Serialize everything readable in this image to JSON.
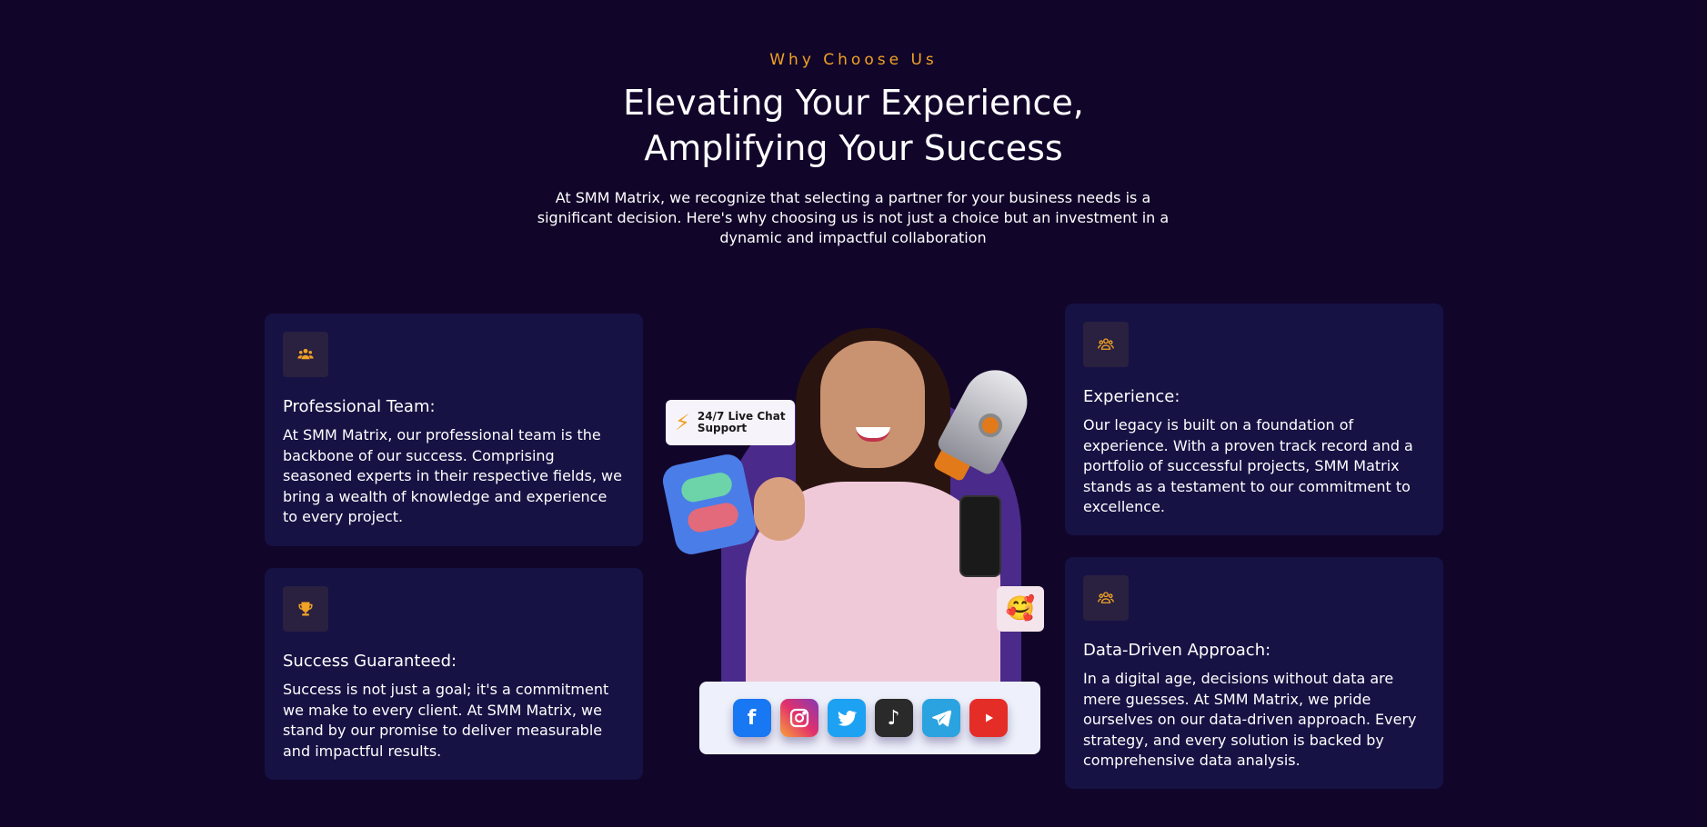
{
  "section": {
    "eyebrow": "Why Choose Us",
    "headline_line1": "Elevating Your Experience,",
    "headline_line2": "Amplifying Your Success",
    "intro": "At SMM Matrix, we recognize that selecting a partner for your business needs is a significant decision. Here's why choosing us is not just a choice but an investment in a dynamic and impactful collaboration"
  },
  "colors": {
    "background": "#12052a",
    "card": "#161244",
    "accent": "#f0a224",
    "icon_box": "#2a2040"
  },
  "cards": [
    {
      "icon": "team-icon",
      "title": "Professional Team:",
      "body": "At SMM Matrix, our professional team is the backbone of our success. Comprising seasoned experts in their respective fields, we bring a wealth of knowledge and experience to every project."
    },
    {
      "icon": "trophy-icon",
      "title": "Success Guaranteed:",
      "body": "Success is not just a goal; it's a commitment we make to every client. At SMM Matrix, we stand by our promise to deliver measurable and impactful results."
    },
    {
      "icon": "team-icon",
      "title": "Experience:",
      "body": "Our legacy is built on a foundation of experience. With a proven track record and a portfolio of successful projects, SMM Matrix stands as a testament to our commitment to excellence."
    },
    {
      "icon": "team-icon",
      "title": "Data-Driven Approach:",
      "body": "In a digital age, decisions without data are mere guesses. At SMM Matrix, we pride ourselves on our data-driven approach. Every strategy, and every solution is backed by comprehensive data analysis."
    }
  ],
  "hero": {
    "chat_badge": "24/7 Live Chat Support",
    "social_icons": [
      "facebook-icon",
      "instagram-icon",
      "twitter-icon",
      "tiktok-icon",
      "telegram-icon",
      "youtube-icon"
    ]
  }
}
